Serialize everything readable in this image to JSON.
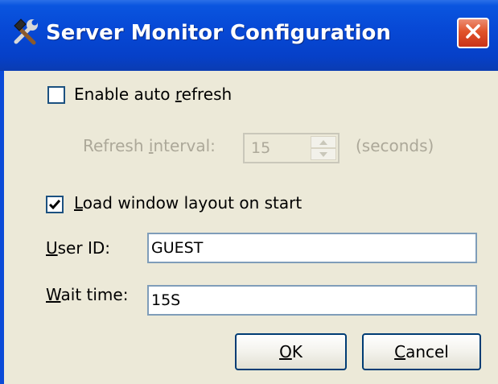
{
  "window": {
    "title": "Server Monitor Configuration",
    "title_icon": "hammer-wrench-icon",
    "close_icon": "close-icon"
  },
  "auto_refresh": {
    "checkbox_label_pre": "Enable auto ",
    "checkbox_label_mnemonic": "r",
    "checkbox_label_post": "efresh",
    "checked": false
  },
  "refresh_interval": {
    "label_pre": "Refresh ",
    "label_mnemonic": "i",
    "label_post": "nterval:",
    "value": "15",
    "unit": "(seconds)",
    "enabled": false
  },
  "load_layout": {
    "checkbox_label_mnemonic": "L",
    "checkbox_label_post": "oad window layout on start",
    "checked": true
  },
  "user_id": {
    "label_mnemonic": "U",
    "label_post": "ser ID:",
    "value": "GUEST"
  },
  "wait_time": {
    "label_mnemonic": "W",
    "label_post": "ait time:",
    "value": "15S"
  },
  "buttons": {
    "ok_mnemonic": "O",
    "ok_post": "K",
    "cancel_mnemonic": "C",
    "cancel_post": "ancel"
  },
  "colors": {
    "titlebar": "#0749d6",
    "dialog_bg": "#ece9d8",
    "disabled_text": "#aca899",
    "close_button": "#e1532a"
  }
}
